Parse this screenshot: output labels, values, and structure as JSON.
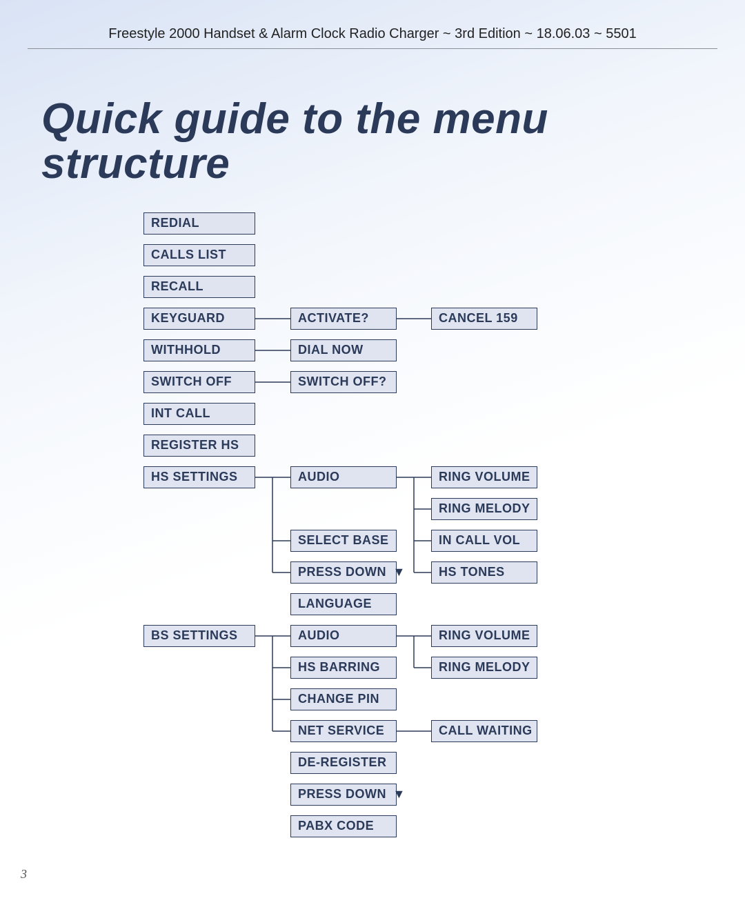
{
  "header": "Freestyle 2000 Handset & Alarm Clock Radio Charger  ~ 3rd Edition ~ 18.06.03 ~ 5501",
  "title": "Quick guide to the menu structure",
  "page_number": "3",
  "menu": {
    "redial": "REDIAL",
    "calls_list": "CALLS LIST",
    "recall": "RECALL",
    "keyguard": "KEYGUARD",
    "keyguard_activate": "ACTIVATE?",
    "keyguard_cancel": "CANCEL 159",
    "withhold": "WITHHOLD",
    "withhold_dial": "DIAL NOW",
    "switch_off": "SWITCH OFF",
    "switch_off_q": "SWITCH OFF?",
    "int_call": "INT CALL",
    "register_hs": "REGISTER HS",
    "hs_settings": "HS SETTINGS",
    "hs_audio": "AUDIO",
    "hs_ring_volume": "RING VOLUME",
    "hs_ring_melody": "RING MELODY",
    "hs_in_call_vol": "IN CALL VOL",
    "hs_tones": "HS TONES",
    "hs_select_base": "SELECT BASE",
    "hs_press_down": "PRESS DOWN ",
    "hs_language": "LANGUAGE",
    "bs_settings": "BS SETTINGS",
    "bs_audio": "AUDIO",
    "bs_ring_volume": "RING VOLUME",
    "bs_ring_melody": "RING MELODY",
    "bs_hs_barring": "HS BARRING",
    "bs_change_pin": "CHANGE PIN",
    "bs_net_service": "NET SERVICE",
    "bs_call_waiting": "CALL WAITING",
    "bs_de_register": "DE-REGISTER",
    "bs_press_down": "PRESS DOWN ",
    "bs_pabx_code": "PABX CODE"
  },
  "icons": {
    "down_arrow": "▼"
  }
}
